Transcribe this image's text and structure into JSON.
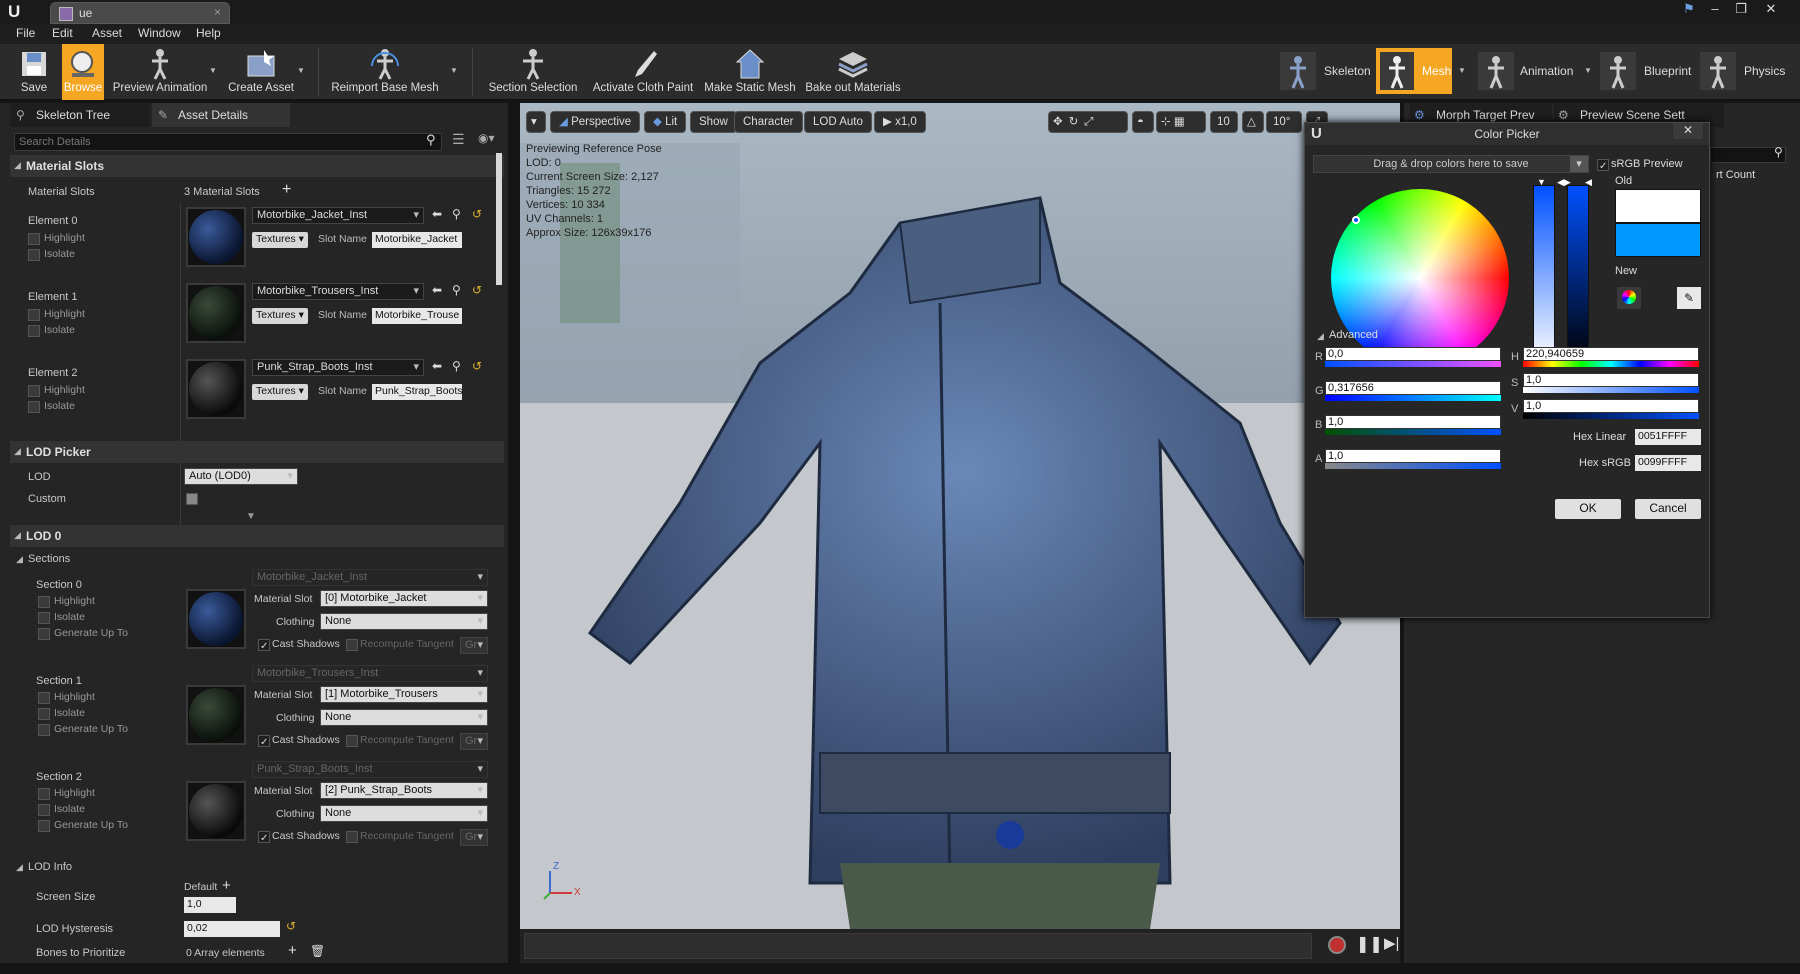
{
  "window": {
    "tab_title": "ue",
    "logo": "U"
  },
  "menu": [
    "File",
    "Edit",
    "Asset",
    "Window",
    "Help"
  ],
  "toolbar": [
    {
      "label": "Save",
      "icon": "save-icon"
    },
    {
      "label": "Browse",
      "icon": "browse-icon"
    },
    {
      "label": "Preview Animation",
      "icon": "preview-animation-icon"
    },
    {
      "label": "Create Asset",
      "icon": "create-asset-icon"
    },
    {
      "label": "Reimport Base Mesh",
      "icon": "reimport-icon"
    },
    {
      "label": "Section Selection",
      "icon": "section-selection-icon"
    },
    {
      "label": "Activate Cloth Paint",
      "icon": "cloth-paint-icon"
    },
    {
      "label": "Make Static Mesh",
      "icon": "static-mesh-icon"
    },
    {
      "label": "Bake out Materials",
      "icon": "bake-materials-icon"
    }
  ],
  "modes": [
    "Skeleton",
    "Mesh",
    "Animation",
    "Blueprint",
    "Physics"
  ],
  "left_tabs": [
    "Skeleton Tree",
    "Asset Details"
  ],
  "search": {
    "placeholder": "Search Details"
  },
  "material_slots": {
    "header": "Material Slots",
    "row_label": "Material Slots",
    "count": "3 Material Slots",
    "highlight": "Highlight",
    "isolate": "Isolate",
    "textures": "Textures",
    "slot_name": "Slot Name",
    "elements": [
      {
        "label": "Element 0",
        "material": "Motorbike_Jacket_Inst",
        "slot": "Motorbike_Jacket"
      },
      {
        "label": "Element 1",
        "material": "Motorbike_Trousers_Inst",
        "slot": "Motorbike_Trouse"
      },
      {
        "label": "Element 2",
        "material": "Punk_Strap_Boots_Inst",
        "slot": "Punk_Strap_Boots"
      }
    ]
  },
  "lod_picker": {
    "header": "LOD Picker",
    "lod_label": "LOD",
    "lod_value": "Auto (LOD0)",
    "custom_label": "Custom"
  },
  "lod0": {
    "header": "LOD 0",
    "sections_header": "Sections",
    "highlight": "Highlight",
    "isolate": "Isolate",
    "generate": "Generate Up To",
    "material_slot_label": "Material Slot",
    "clothing_label": "Clothing",
    "clothing_value": "None",
    "cast_shadows": "Cast Shadows",
    "recompute": "Recompute Tangent",
    "gr": "Gr",
    "sections": [
      {
        "label": "Section 0",
        "material": "Motorbike_Jacket_Inst",
        "slot": "[0] Motorbike_Jacket"
      },
      {
        "label": "Section 1",
        "material": "Motorbike_Trousers_Inst",
        "slot": "[1] Motorbike_Trousers"
      },
      {
        "label": "Section 2",
        "material": "Punk_Strap_Boots_Inst",
        "slot": "[2] Punk_Strap_Boots"
      }
    ]
  },
  "lod_info": {
    "header": "LOD Info",
    "screen_size_label": "Screen Size",
    "screen_default": "Default",
    "screen_value": "1,0",
    "hysteresis_label": "LOD Hysteresis",
    "hysteresis_value": "0,02",
    "bones_label": "Bones to Prioritize",
    "bones_value": "0 Array elements"
  },
  "viewport": {
    "buttons": [
      "Perspective",
      "Lit",
      "Show",
      "Character",
      "LOD Auto",
      "x1,0"
    ],
    "right_icons": [
      "10",
      "10°"
    ],
    "stats": [
      "Previewing Reference Pose",
      "LOD: 0",
      "Current Screen Size: 2,127",
      "Triangles: 15 272",
      "Vertices: 10 334",
      "UV Channels: 1",
      "Approx Size: 126x39x176"
    ],
    "axis_z": "Z",
    "axis_x": "X"
  },
  "right_tabs": [
    "Morph Target Prev",
    "Preview Scene Sett"
  ],
  "right_partial": "rt Count",
  "color_picker": {
    "title": "Color Picker",
    "drop_hint": "Drag & drop colors here to save",
    "srgb_preview": "sRGB Preview",
    "old_label": "Old",
    "new_label": "New",
    "advanced": "Advanced",
    "old_color": "#ffffff",
    "new_color": "#0099ff",
    "r": "0,0",
    "g": "0,317656",
    "b": "1,0",
    "a": "1,0",
    "h": "220,940659",
    "s": "1,0",
    "v": "1,0",
    "hex_linear_label": "Hex Linear",
    "hex_linear": "0051FFFF",
    "hex_srgb_label": "Hex sRGB",
    "hex_srgb": "0099FFFF",
    "ok": "OK",
    "cancel": "Cancel"
  },
  "colors": {
    "accent": "#f5a623",
    "panel": "#252525",
    "picker_new": "#0099ff"
  }
}
